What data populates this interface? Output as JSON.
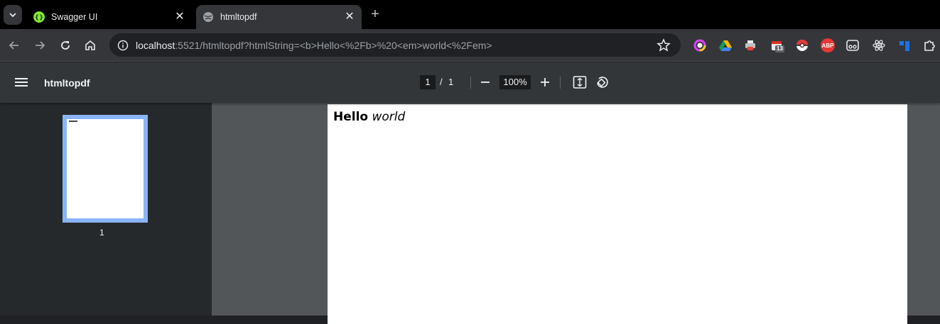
{
  "tabs": [
    {
      "title": "Swagger UI",
      "favicon": "swagger-icon",
      "active": false
    },
    {
      "title": "htmltopdf",
      "favicon": "globe-icon",
      "active": true
    }
  ],
  "address": {
    "host": "localhost",
    "rest": ":5521/htmltopdf?htmlString=<b>Hello<%2Fb>%20<em>world<%2Fem>"
  },
  "extensions": [
    {
      "name": "colorful-ring-extension-icon",
      "color": "#e8eaed"
    },
    {
      "name": "google-drive-icon",
      "color": "#1fa463"
    },
    {
      "name": "printer-extension-icon",
      "color": "#e8eaed"
    },
    {
      "name": "calendar-extension-icon",
      "color": "#d93025",
      "badge": "13"
    },
    {
      "name": "pokeball-extension-icon",
      "color": "#e53935"
    },
    {
      "name": "adblock-plus-icon",
      "color": "#e53935",
      "label": "ABP"
    },
    {
      "name": "glasses-extension-icon",
      "color": "#e8eaed"
    },
    {
      "name": "react-devtools-icon",
      "color": "#e8eaed"
    },
    {
      "name": "blue-bar-extension-icon",
      "color": "#1a73e8"
    },
    {
      "name": "puzzle-extensions-icon",
      "color": "#e8eaed"
    }
  ],
  "pdf": {
    "title": "htmltopdf",
    "current_page": "1",
    "separator": "/",
    "total_pages": "1",
    "zoom": "100%",
    "thumbnail_label": "1",
    "content_bold": "Hello",
    "content_italic": "world"
  }
}
